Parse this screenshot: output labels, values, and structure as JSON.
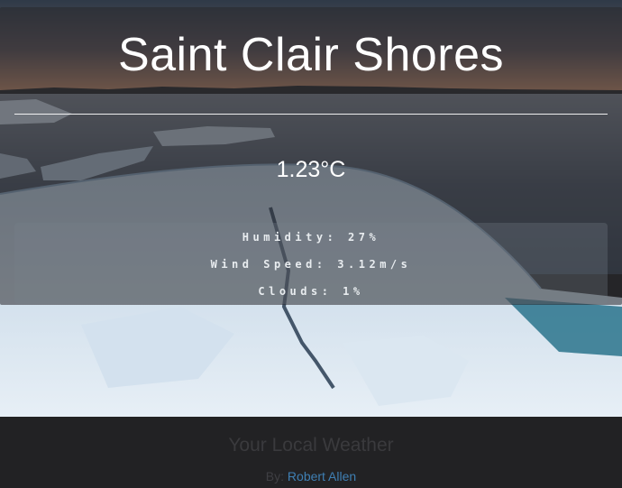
{
  "weather": {
    "city": "Saint Clair Shores",
    "temperature": "1.23°C",
    "humidity": "Humidity: 27%",
    "wind_speed": "Wind Speed: 3.12m/s",
    "clouds": "Clouds: 1%"
  },
  "footer": {
    "app_title": "Your Local Weather",
    "by_label": "By:",
    "author": "Robert Allen"
  },
  "colors": {
    "link": "#3f7fb3",
    "footer_bg": "#222224"
  }
}
